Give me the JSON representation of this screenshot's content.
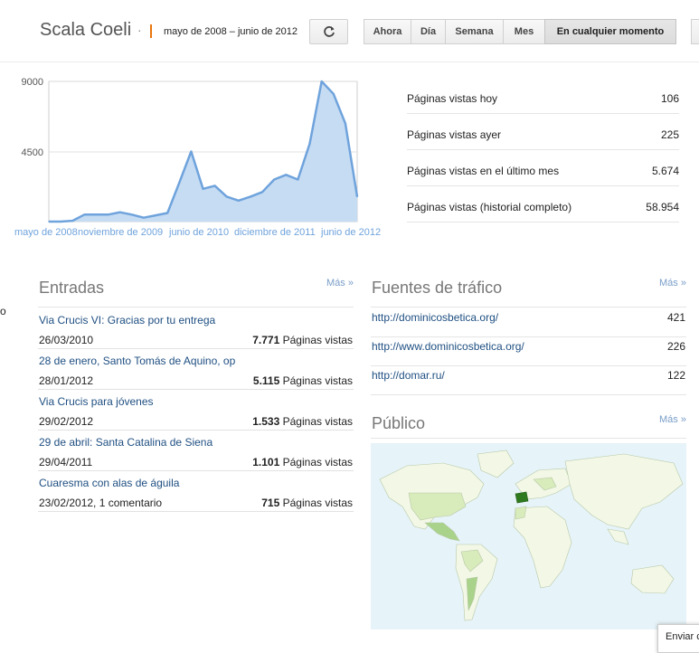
{
  "header": {
    "blog_title": "Scala Coeli",
    "separator": "·",
    "date_range": "mayo de 2008 – junio de 2012",
    "ranges": [
      "Ahora",
      "Día",
      "Semana",
      "Mes",
      "En cualquier momento"
    ],
    "selected_range": "En cualquier momento"
  },
  "chart_data": {
    "type": "area",
    "x": [
      "mayo de 2008",
      "jun 2008",
      "jul 2008",
      "sep 2008",
      "nov 2008",
      "ene 2009",
      "mar 2009",
      "may 2009",
      "jul 2009",
      "sep 2009",
      "nov 2009",
      "ene 2010",
      "mar 2010",
      "may 2010",
      "jul 2010",
      "sep 2010",
      "nov 2010",
      "ene 2011",
      "mar 2011",
      "may 2011",
      "jul 2011",
      "sep 2011",
      "nov 2011",
      "ene 2012",
      "mar 2012",
      "may 2012",
      "jun 2012"
    ],
    "values": [
      0,
      0,
      50,
      450,
      450,
      450,
      600,
      450,
      250,
      400,
      550,
      2500,
      4500,
      2100,
      2300,
      1600,
      1350,
      1600,
      1900,
      2700,
      3000,
      2700,
      5000,
      9000,
      8200,
      6300,
      1600
    ],
    "tick_labels": [
      "mayo de 2008",
      "noviembre de 2009",
      "junio de 2010",
      "diciembre de 2011",
      "junio de 2012"
    ],
    "yticks": [
      "9000",
      "4500"
    ],
    "ylim": [
      0,
      9000
    ],
    "grid": true,
    "color": "#6fa3dc",
    "fill": "#c6dcf3"
  },
  "stats": [
    {
      "label": "Páginas vistas hoy",
      "value": "106"
    },
    {
      "label": "Páginas vistas ayer",
      "value": "225"
    },
    {
      "label": "Páginas vistas en el último mes",
      "value": "5.674"
    },
    {
      "label": "Páginas vistas (historial completo)",
      "value": "58.954"
    }
  ],
  "entradas": {
    "title": "Entradas",
    "more": "Más »",
    "posts": [
      {
        "title": "Via Crucis VI: Gracias por tu entrega",
        "date": "26/03/2010",
        "views": "7.771",
        "views_label": "Páginas vistas"
      },
      {
        "title": "28 de enero, Santo Tomás de Aquino, op",
        "date": "28/01/2012",
        "views": "5.115",
        "views_label": "Páginas vistas"
      },
      {
        "title": "Via Crucis para jóvenes",
        "date": "29/02/2012",
        "views": "1.533",
        "views_label": "Páginas vistas"
      },
      {
        "title": "29 de abril: Santa Catalina de Siena",
        "date": "29/04/2011",
        "views": "1.101",
        "views_label": "Páginas vistas"
      },
      {
        "title": "Cuaresma con alas de águila",
        "date": "23/02/2012, 1 comentario",
        "views": "715",
        "views_label": "Páginas vistas"
      }
    ]
  },
  "fuentes": {
    "title": "Fuentes de tráfico",
    "more": "Más »",
    "items": [
      {
        "url": "http://dominicosbetica.org/",
        "count": "421"
      },
      {
        "url": "http://www.dominicosbetica.org/",
        "count": "226"
      },
      {
        "url": "http://domar.ru/",
        "count": "122"
      }
    ]
  },
  "publico": {
    "title": "Público",
    "more": "Más »",
    "colors": {
      "water": "#e6f3f8",
      "land": "#f3f8e6",
      "light": "#d8ebbb",
      "medium": "#a9d28a",
      "top": "#2f7a1f"
    }
  },
  "left_stub": "o",
  "feedback": "Enviar c"
}
